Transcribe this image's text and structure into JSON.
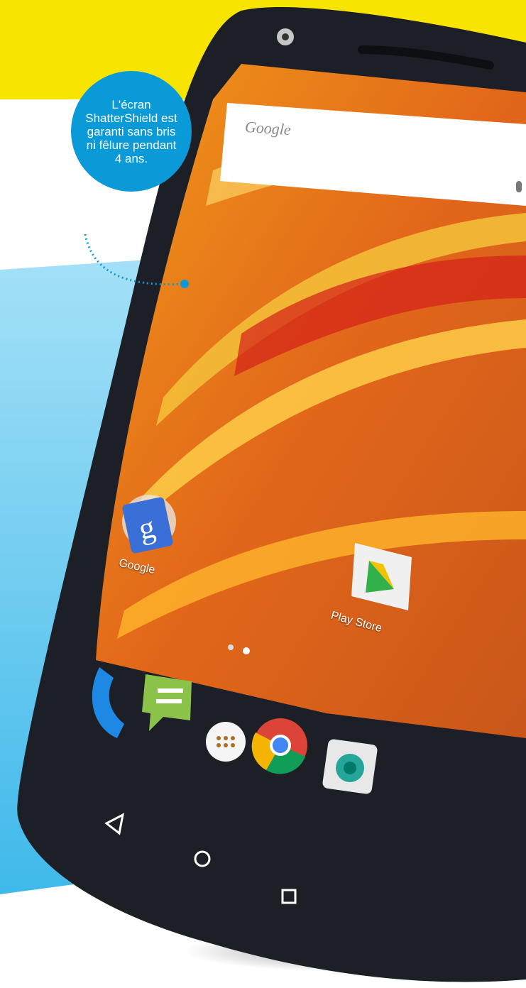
{
  "callout": {
    "text": "L'écran ShatterShield est garanti sans bris ni fêlure pendant 4 ans."
  },
  "screen": {
    "search_brand": "Google",
    "apps": [
      {
        "label": "Google",
        "icon": "google-search-icon"
      },
      {
        "label": "Play Store",
        "icon": "play-store-icon"
      }
    ],
    "dock": [
      "phone-icon",
      "messaging-icon",
      "app-drawer-icon",
      "chrome-icon",
      "camera-icon"
    ],
    "nav": [
      "back-icon",
      "home-icon",
      "recents-icon"
    ]
  },
  "colors": {
    "yellow": "#f7e400",
    "callout_blue": "#0a9ad8",
    "sky": "#5fc6ee",
    "phone_body": "#1c1f26"
  }
}
